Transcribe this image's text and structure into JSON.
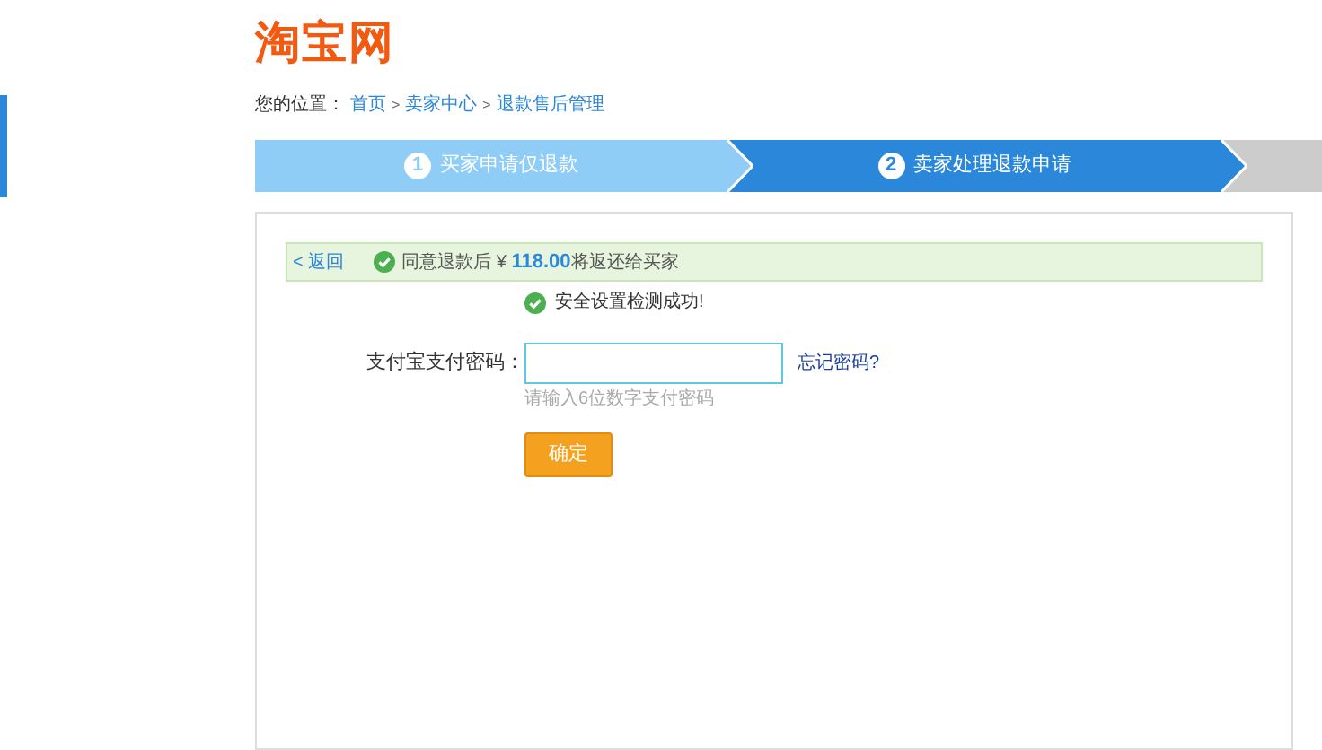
{
  "logo": "淘宝网",
  "breadcrumb": {
    "label": "您的位置：",
    "separator": ">",
    "links": [
      "首页",
      "卖家中心",
      "退款售后管理"
    ]
  },
  "steps": [
    {
      "number": "1",
      "label": "买家申请仅退款",
      "kind": "done"
    },
    {
      "number": "2",
      "label": "卖家处理退款申请",
      "kind": "current"
    },
    {
      "kind": "pending"
    }
  ],
  "notice": {
    "back": "< 返回",
    "prefix": "同意退款后 ¥ ",
    "amount": "118.00",
    "suffix": "将返还给买家"
  },
  "security_message": "安全设置检测成功!",
  "form": {
    "label": "支付宝支付密码：",
    "forgot_link": "忘记密码?",
    "hint": "请输入6位数字支付密码",
    "submit": "确定"
  }
}
